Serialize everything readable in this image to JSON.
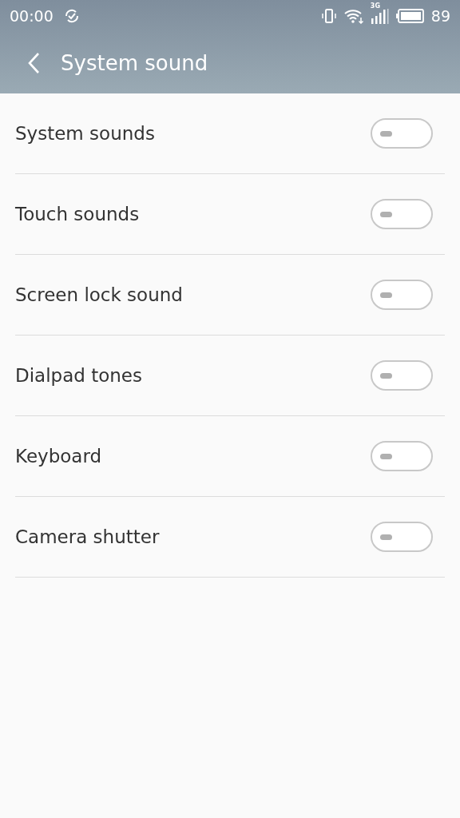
{
  "status_bar": {
    "time": "00:00",
    "network": "3G",
    "battery": "89"
  },
  "header": {
    "title": "System sound"
  },
  "settings": [
    {
      "label": "System sounds",
      "on": false
    },
    {
      "label": "Touch sounds",
      "on": false
    },
    {
      "label": "Screen lock sound",
      "on": false
    },
    {
      "label": "Dialpad tones",
      "on": false
    },
    {
      "label": "Keyboard",
      "on": false
    },
    {
      "label": "Camera shutter",
      "on": false
    }
  ]
}
